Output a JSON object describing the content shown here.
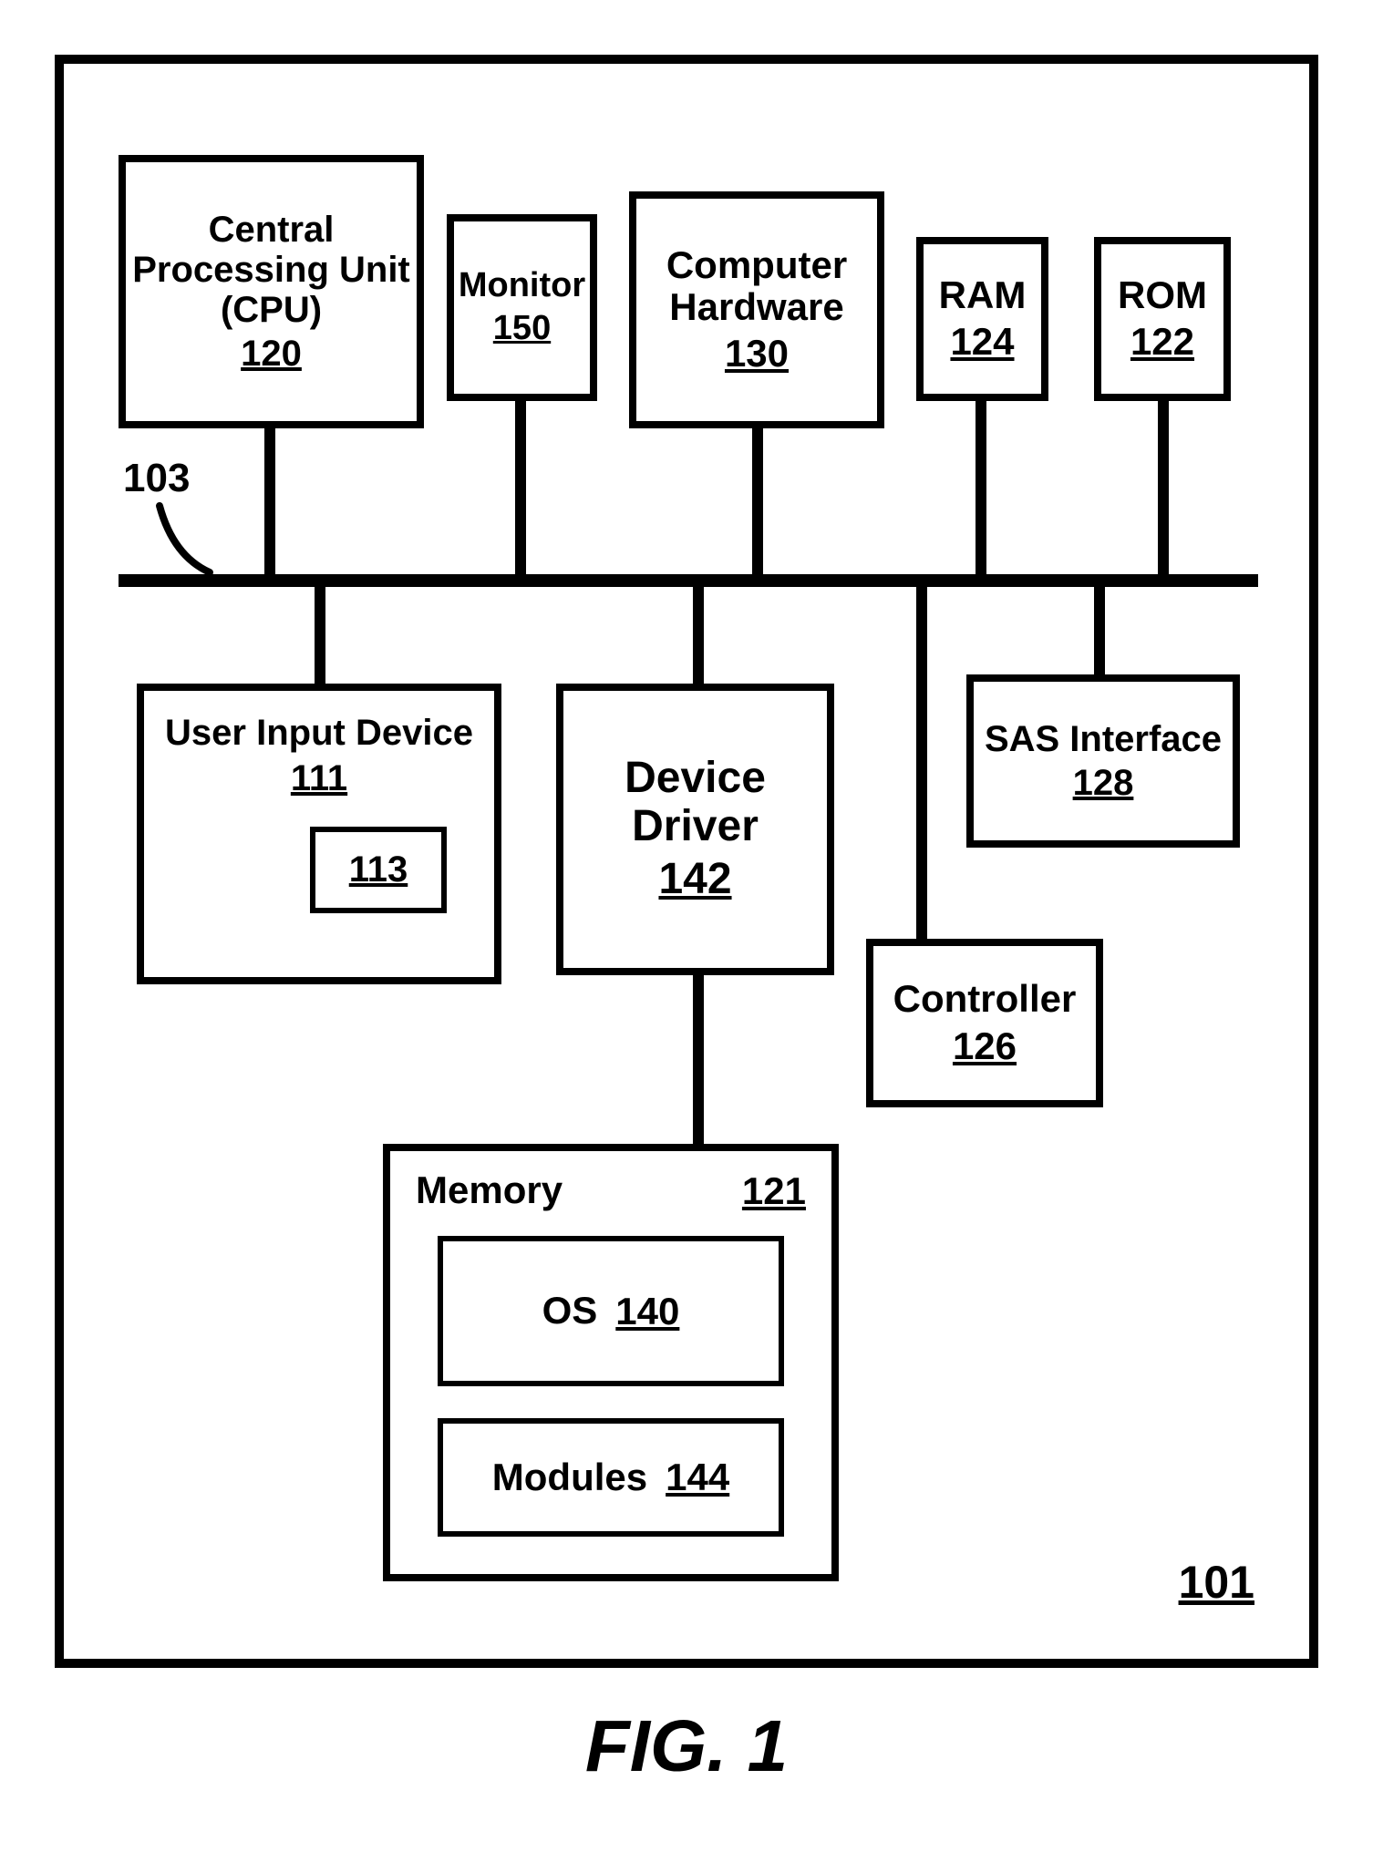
{
  "figure_caption": "FIG. 1",
  "system_ref": "101",
  "bus_ref": "103",
  "blocks": {
    "cpu": {
      "label": "Central\nProcessing Unit\n(CPU)",
      "ref": "120"
    },
    "monitor": {
      "label": "Monitor",
      "ref": "150"
    },
    "hardware": {
      "label": "Computer\nHardware",
      "ref": "130"
    },
    "ram": {
      "label": "RAM",
      "ref": "124"
    },
    "rom": {
      "label": "ROM",
      "ref": "122"
    },
    "uid": {
      "label": "User Input Device",
      "ref": "111",
      "inner_ref": "113"
    },
    "driver": {
      "label": "Device\nDriver",
      "ref": "142"
    },
    "sas": {
      "label": "SAS Interface",
      "ref": "128"
    },
    "controller": {
      "label": "Controller",
      "ref": "126"
    },
    "memory": {
      "label": "Memory",
      "ref": "121",
      "os": {
        "label": "OS",
        "ref": "140"
      },
      "modules": {
        "label": "Modules",
        "ref": "144"
      }
    }
  }
}
